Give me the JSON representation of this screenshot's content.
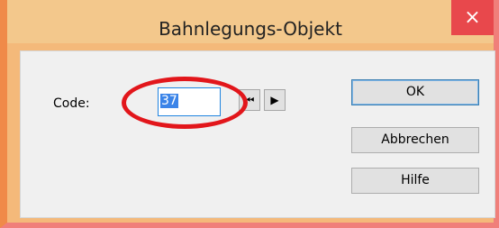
{
  "window": {
    "title": "Bahnlegungs-Objekt",
    "close_glyph": "×"
  },
  "form": {
    "code_label": "Code:",
    "code_value": "37",
    "nav_first_icon": "first-record-icon",
    "nav_first_glyph": "⏮",
    "nav_next_icon": "next-record-icon",
    "nav_next_glyph": "▶"
  },
  "buttons": {
    "ok": "OK",
    "cancel": "Abbrechen",
    "help": "Hilfe"
  },
  "colors": {
    "titlebar": "#f3c88c",
    "close": "#e8484c",
    "annotation": "#e2161b",
    "selection": "#3b84e8"
  }
}
